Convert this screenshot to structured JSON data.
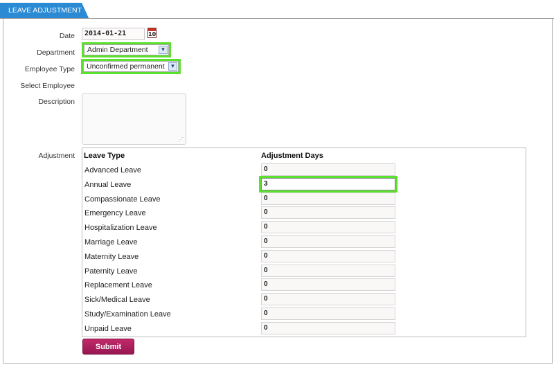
{
  "tab": {
    "label": "LEAVE ADJUSTMENT"
  },
  "form": {
    "date_label": "Date",
    "date_value": "2014-01-21",
    "calendar_icon": "calendar-icon",
    "calendar_day": "10",
    "department_label": "Department",
    "department_value": "Admin Department",
    "employee_type_label": "Employee Type",
    "employee_type_value": "Unconfirmed permanent st",
    "select_employee_label": "Select Employee",
    "description_label": "Description",
    "description_value": "",
    "adjustment_label": "Adjustment"
  },
  "adjustment": {
    "col_leave_type": "Leave Type",
    "col_days": "Adjustment Days",
    "rows": [
      {
        "type": "Advanced Leave",
        "days": "0"
      },
      {
        "type": "Annual Leave",
        "days": "3"
      },
      {
        "type": "Compassionate Leave",
        "days": "0"
      },
      {
        "type": "Emergency Leave",
        "days": "0"
      },
      {
        "type": "Hospitalization Leave",
        "days": "0"
      },
      {
        "type": "Marriage Leave",
        "days": "0"
      },
      {
        "type": "Maternity Leave",
        "days": "0"
      },
      {
        "type": "Paternity Leave",
        "days": "0"
      },
      {
        "type": "Replacement Leave",
        "days": "0"
      },
      {
        "type": "Sick/Medical Leave",
        "days": "0"
      },
      {
        "type": "Study/Examination Leave",
        "days": "0"
      },
      {
        "type": "Unpaid Leave",
        "days": "0"
      }
    ]
  },
  "submit_label": "Submit",
  "colors": {
    "tab": "#2a8ad4",
    "highlight": "#5ce02e",
    "submit": "#b0205f"
  }
}
